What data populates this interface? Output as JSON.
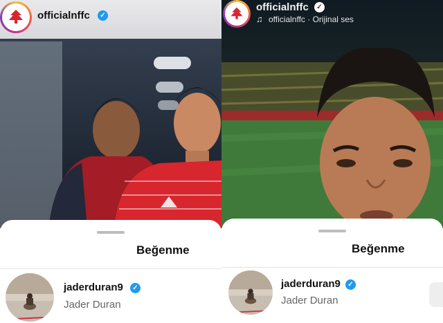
{
  "left": {
    "account": "officialnffc",
    "sheet_title": "Beğenme",
    "liker": {
      "username": "jaderduran9",
      "full_name": "Jader Duran"
    }
  },
  "right": {
    "account": "officialnffc",
    "audio": "officialnffc · Orijinal ses",
    "sheet_title": "Beğenme",
    "liker": {
      "username": "jaderduran9",
      "full_name": "Jader Duran"
    }
  },
  "colors": {
    "verified": "#1d9bf0",
    "brand_red": "#d7262e",
    "pitch_green": "#3f7a3a"
  }
}
